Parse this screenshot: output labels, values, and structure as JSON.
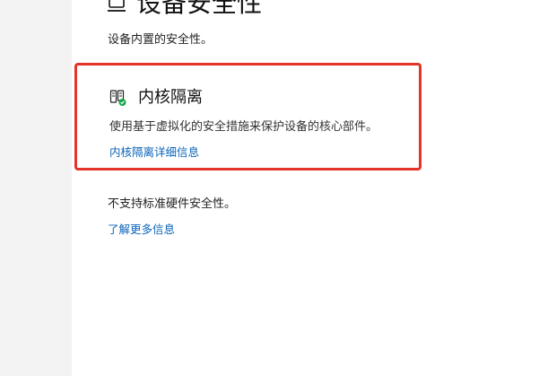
{
  "header": {
    "title": "设备安全性",
    "subtitle": "设备内置的安全性。",
    "icon": "device-security-icon"
  },
  "core_isolation": {
    "icon": "core-isolation-icon",
    "title": "内核隔离",
    "description": "使用基于虚拟化的安全措施来保护设备的核心部件。",
    "link_label": "内核隔离详细信息"
  },
  "hardware_security": {
    "status_text": "不支持标准硬件安全性。",
    "link_label": "了解更多信息"
  },
  "colors": {
    "highlight_border": "#e4342a",
    "link": "#0a64b8",
    "status_ok": "#16a34a"
  }
}
